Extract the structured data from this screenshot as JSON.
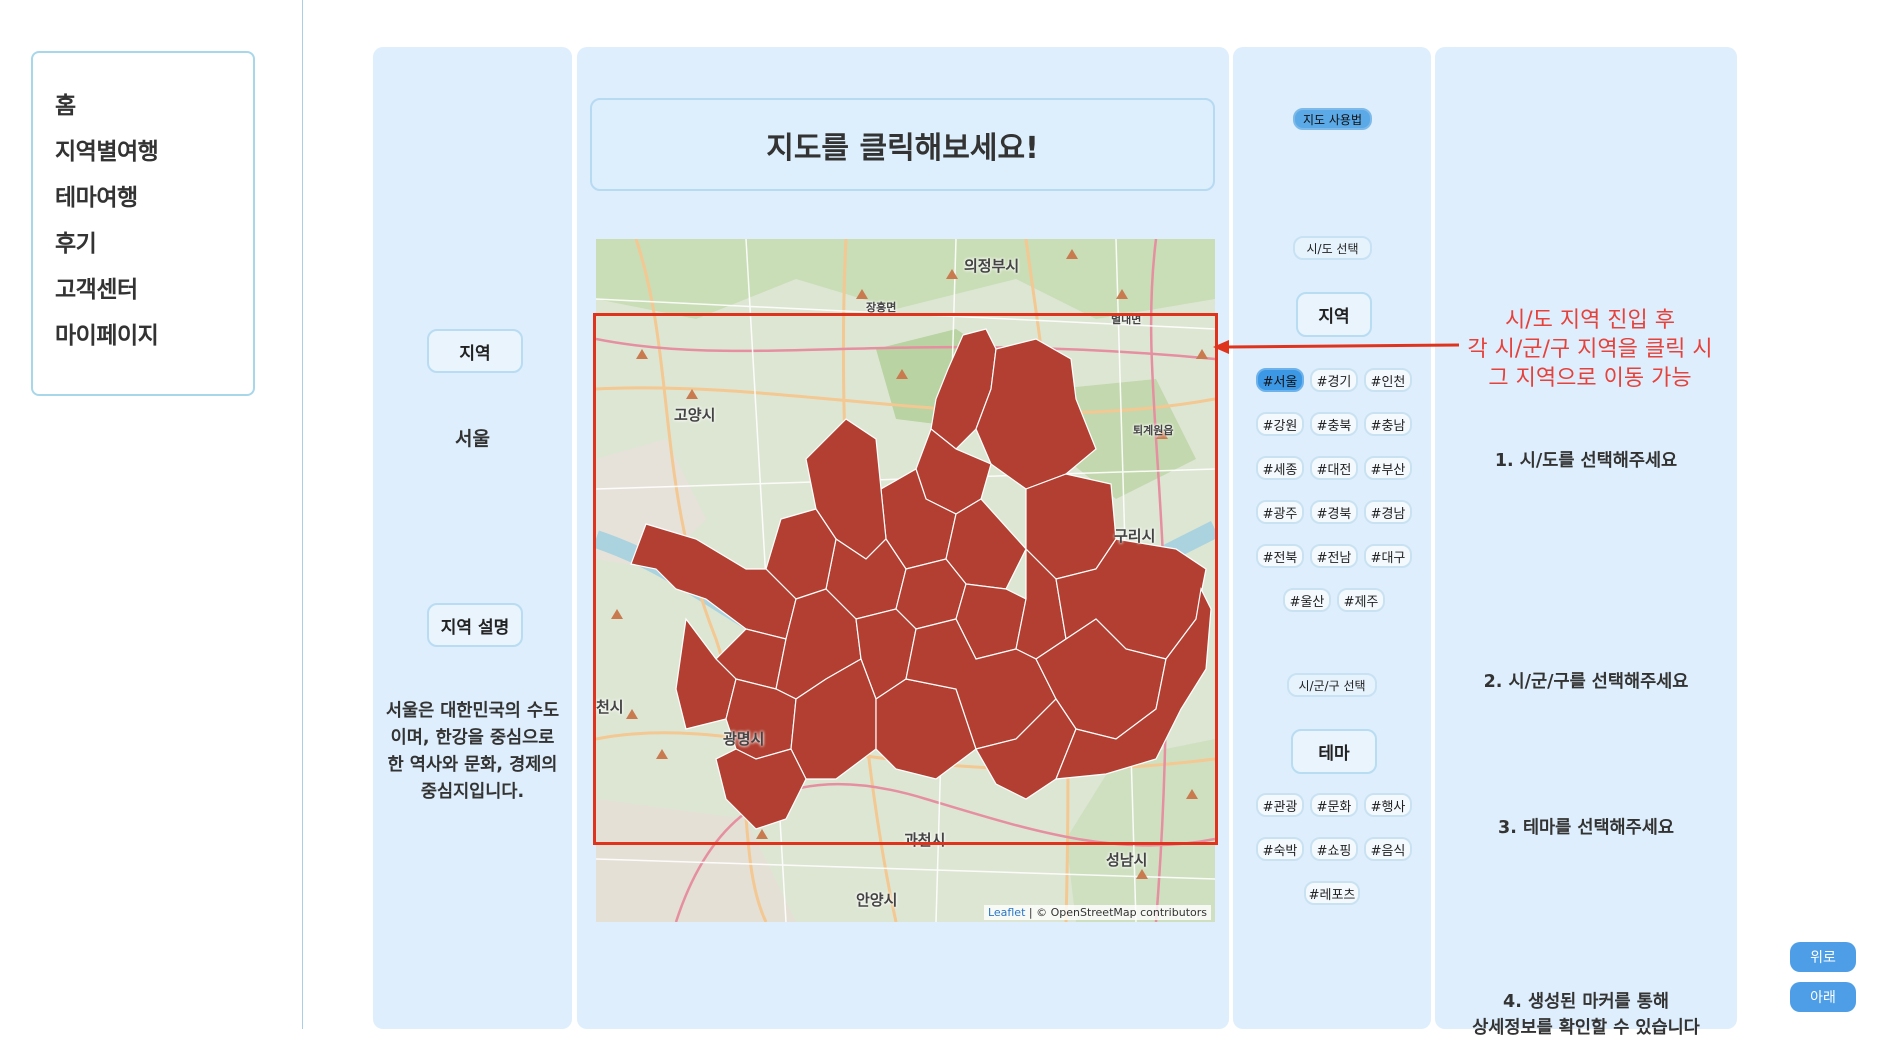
{
  "nav": {
    "items": [
      {
        "label": "홈"
      },
      {
        "label": "지역별여행"
      },
      {
        "label": "테마여행"
      },
      {
        "label": "후기"
      },
      {
        "label": "고객센터"
      },
      {
        "label": "마이페이지"
      }
    ]
  },
  "info_panel": {
    "region_heading": "지역",
    "region_name": "서울",
    "description_heading": "지역 설명",
    "description": "서울은 대한민국의 수도이며, 한강을 중심으로 한 역사와 문화, 경제의 중심지입니다."
  },
  "map_panel": {
    "title": "지도를 클릭해보세요!",
    "place_labels": {
      "uijeongbu": "의정부시",
      "goyang": "고양시",
      "guri": "구리시",
      "gwangmyeong": "광명시",
      "gwacheon": "과천시",
      "seongnam": "성남시",
      "anyang": "안양시",
      "jangheung": "장흥면",
      "byeollae": "별내면",
      "toegyewon": "퇴계원읍",
      "bucheon": "천시"
    },
    "attribution_leaflet": "Leaflet",
    "attribution_rest": " | © OpenStreetMap contributors",
    "region_fill_color": "#b23f31",
    "frame_color": "#e0331e"
  },
  "filter_panel": {
    "usage_label": "지도 사용법",
    "sido_select_label": "시/도 선택",
    "region_label": "지역",
    "region_tags": [
      "#서울",
      "#경기",
      "#인천",
      "#강원",
      "#충북",
      "#충남",
      "#세종",
      "#대전",
      "#부산",
      "#광주",
      "#경북",
      "#경남",
      "#전북",
      "#전남",
      "#대구",
      "#울산",
      "#제주"
    ],
    "active_region_tag": "#서울",
    "sgg_select_label": "시/군/구 선택",
    "theme_label": "테마",
    "theme_tags": [
      "#관광",
      "#문화",
      "#행사",
      "#숙박",
      "#쇼핑",
      "#음식",
      "#레포츠"
    ],
    "active_color": "#3c98e4"
  },
  "guide_panel": {
    "annotation_lines": [
      "시/도 지역 진입 후",
      "각 시/군/구 지역을 클릭 시",
      "그 지역으로 이동 가능"
    ],
    "annotation_color": "#e6413a",
    "step1": "1. 시/도를 선택해주세요",
    "step2": "2. 시/군/구를 선택해주세요",
    "step3": "3. 테마를 선택해주세요",
    "step4_line1": "4. 생성된 마커를 통해",
    "step4_line2": "상세정보를 확인할 수 있습니다"
  },
  "scroll": {
    "up_label": "위로",
    "down_label": "아래"
  }
}
